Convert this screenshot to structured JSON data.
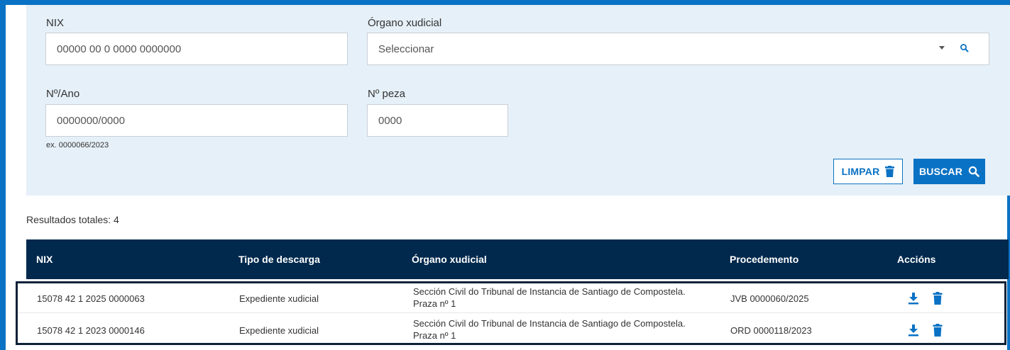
{
  "filters": {
    "nix": {
      "label": "NIX",
      "placeholder": "00000 00 0 0000 0000000"
    },
    "organo": {
      "label": "Órgano xudicial",
      "placeholder": "Seleccionar"
    },
    "numero_ano": {
      "label": "Nº/Ano",
      "placeholder": "0000000/0000",
      "hint": "ex. 0000066/2023"
    },
    "peza": {
      "label": "Nº peza",
      "placeholder": "0000"
    },
    "buttons": {
      "clear_label": "LIMPAR",
      "search_label": "BUSCAR"
    }
  },
  "results": {
    "total_text": "Resultados totales: 4",
    "columns": [
      "NIX",
      "Tipo de descarga",
      "Órgano xudicial",
      "Procedemento",
      "Accións"
    ],
    "rows": [
      {
        "nix": "15078 42 1 2025 0000063",
        "tipo": "Expediente xudicial",
        "organo_line1": "Sección Civil do Tribunal de Instancia de Santiago de Compostela.",
        "organo_line2": "Praza nº 1",
        "procedemento": "JVB 0000060/2025"
      },
      {
        "nix": "15078 42 1 2023 0000146",
        "tipo": "Expediente xudicial",
        "organo_line1": "Sección Civil do Tribunal de Instancia de Santiago de Compostela.",
        "organo_line2": "Praza nº 1",
        "procedemento": "ORD 0000118/2023"
      }
    ]
  },
  "colors": {
    "accent": "#0a72c4",
    "header_bg": "#00294d",
    "filter_bg": "#e6f0f8"
  },
  "icons": {
    "download": "download-icon",
    "delete": "trash-icon",
    "search": "search-icon",
    "dropdown": "chevron-down-icon"
  }
}
